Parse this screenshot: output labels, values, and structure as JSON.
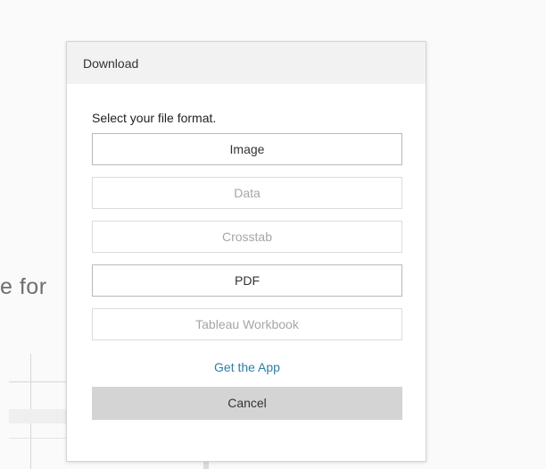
{
  "background": {
    "partial_text": "e for"
  },
  "dialog": {
    "title": "Download",
    "prompt": "Select your file format.",
    "options": [
      {
        "label": "Image",
        "enabled": true
      },
      {
        "label": "Data",
        "enabled": false
      },
      {
        "label": "Crosstab",
        "enabled": false
      },
      {
        "label": "PDF",
        "enabled": true
      },
      {
        "label": "Tableau Workbook",
        "enabled": false
      }
    ],
    "get_app_label": "Get the App",
    "cancel_label": "Cancel"
  },
  "colors": {
    "header_bg": "#f2f2f2",
    "link": "#2e7ea6",
    "cancel_bg": "#d4d4d4",
    "disabled_text": "#a6a6a6"
  }
}
